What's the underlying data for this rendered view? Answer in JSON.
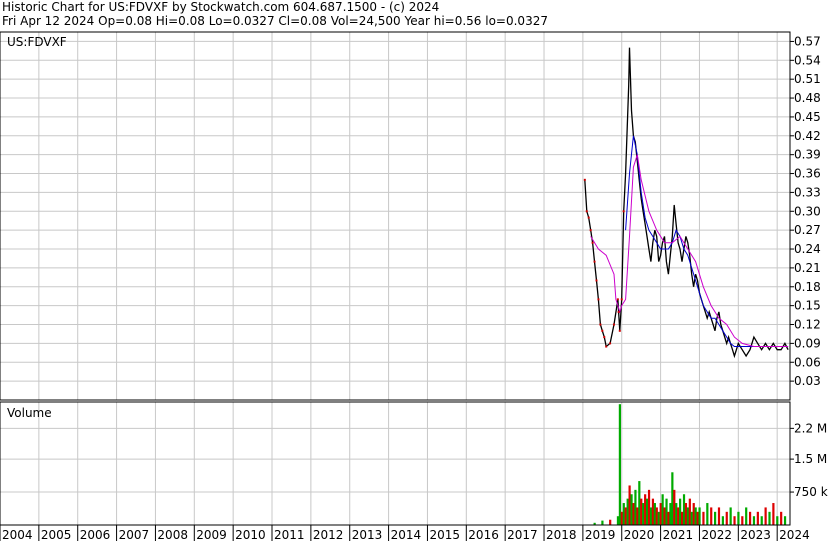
{
  "header": {
    "line1": "Historic Chart for US:FDVXF by Stockwatch.com 604.687.1500 - (c) 2024",
    "line2": "Fri Apr 12 2024   Op=0.08  Hi=0.08  Lo=0.0327  Cl=0.08  Vol=24,500  Year hi=0.56  lo=0.0327"
  },
  "price_panel": {
    "symbol_label": "US:FDVXF"
  },
  "volume_panel": {
    "label": "Volume"
  },
  "chart_data": [
    {
      "type": "line",
      "title": "US:FDVXF",
      "y_ticks": [
        "0.57",
        "0.54",
        "0.51",
        "0.48",
        "0.45",
        "0.42",
        "0.39",
        "0.36",
        "0.33",
        "0.30",
        "0.27",
        "0.24",
        "0.21",
        "0.18",
        "0.15",
        "0.12",
        "0.09",
        "0.06",
        "0.03"
      ],
      "ylim": [
        0.0,
        0.585
      ],
      "xlim": [
        2004.0,
        2024.33
      ],
      "grid": true,
      "colors": {
        "price": "#000000",
        "ma_short": "#0000cc",
        "ma_long": "#cc00cc",
        "sparse_marks": "#cc0000"
      },
      "series": [
        {
          "name": "",
          "x": [
            2019.05,
            2019.1,
            2019.15,
            2019.2,
            2019.25,
            2019.3,
            2019.35,
            2019.4,
            2019.45,
            2019.5,
            2019.55,
            2019.6,
            2019.7,
            2019.8,
            2019.9,
            2019.92,
            2019.95,
            2020.0,
            2020.05,
            2020.1,
            2020.15,
            2020.18,
            2020.2,
            2020.22,
            2020.25,
            2020.3,
            2020.35,
            2020.4,
            2020.45,
            2020.5,
            2020.55,
            2020.6,
            2020.65,
            2020.7,
            2020.75,
            2020.8,
            2020.85,
            2020.9,
            2020.95,
            2021.0,
            2021.05,
            2021.1,
            2021.15,
            2021.2,
            2021.25,
            2021.3,
            2021.35,
            2021.4,
            2021.45,
            2021.5,
            2021.55,
            2021.6,
            2021.65,
            2021.7,
            2021.75,
            2021.8,
            2021.85,
            2021.9,
            2021.95,
            2022.0,
            2022.05,
            2022.1,
            2022.15,
            2022.2,
            2022.25,
            2022.3,
            2022.35,
            2022.4,
            2022.45,
            2022.5,
            2022.55,
            2022.6,
            2022.65,
            2022.7,
            2022.75,
            2022.8,
            2022.85,
            2022.9,
            2022.95,
            2023.0,
            2023.1,
            2023.2,
            2023.3,
            2023.4,
            2023.5,
            2023.6,
            2023.7,
            2023.8,
            2023.9,
            2024.0,
            2024.1,
            2024.2,
            2024.28
          ],
          "y": [
            0.35,
            0.3,
            0.29,
            0.27,
            0.25,
            0.22,
            0.19,
            0.16,
            0.12,
            0.11,
            0.1,
            0.085,
            0.09,
            0.12,
            0.16,
            0.14,
            0.11,
            0.16,
            0.3,
            0.36,
            0.45,
            0.5,
            0.56,
            0.52,
            0.46,
            0.42,
            0.41,
            0.38,
            0.35,
            0.32,
            0.3,
            0.28,
            0.26,
            0.24,
            0.22,
            0.25,
            0.27,
            0.26,
            0.22,
            0.23,
            0.25,
            0.26,
            0.22,
            0.2,
            0.23,
            0.26,
            0.31,
            0.28,
            0.25,
            0.24,
            0.22,
            0.24,
            0.26,
            0.25,
            0.23,
            0.2,
            0.18,
            0.2,
            0.19,
            0.17,
            0.16,
            0.15,
            0.14,
            0.13,
            0.14,
            0.13,
            0.12,
            0.11,
            0.13,
            0.14,
            0.12,
            0.11,
            0.1,
            0.09,
            0.1,
            0.09,
            0.08,
            0.07,
            0.08,
            0.09,
            0.08,
            0.07,
            0.08,
            0.1,
            0.09,
            0.08,
            0.09,
            0.08,
            0.09,
            0.08,
            0.08,
            0.09,
            0.08
          ]
        },
        {
          "name": "",
          "x": [
            2020.1,
            2020.2,
            2020.3,
            2020.4,
            2020.5,
            2020.6,
            2020.7,
            2020.8,
            2020.9,
            2021.0,
            2021.1,
            2021.2,
            2021.3,
            2021.4,
            2021.5,
            2021.6,
            2021.7,
            2021.8,
            2021.9,
            2022.0,
            2022.1,
            2022.2,
            2022.3,
            2022.4,
            2022.5,
            2022.6,
            2022.7,
            2022.8,
            2022.9,
            2023.0,
            2023.2,
            2023.4,
            2023.6,
            2023.8,
            2024.0,
            2024.2,
            2024.28
          ],
          "y": [
            0.27,
            0.36,
            0.42,
            0.39,
            0.33,
            0.29,
            0.27,
            0.26,
            0.25,
            0.24,
            0.24,
            0.24,
            0.25,
            0.27,
            0.26,
            0.24,
            0.23,
            0.21,
            0.19,
            0.17,
            0.15,
            0.14,
            0.13,
            0.13,
            0.12,
            0.11,
            0.1,
            0.09,
            0.085,
            0.085,
            0.085,
            0.085,
            0.085,
            0.085,
            0.085,
            0.085,
            0.085
          ]
        },
        {
          "name": "",
          "x": [
            2019.2,
            2019.4,
            2019.6,
            2019.8,
            2019.85,
            2019.9,
            2019.95,
            2020.0,
            2020.1,
            2020.2,
            2020.3,
            2020.4,
            2020.5,
            2020.7,
            2020.9,
            2021.1,
            2021.3,
            2021.5,
            2021.7,
            2021.9,
            2022.1,
            2022.3,
            2022.5,
            2022.7,
            2022.9,
            2023.1,
            2023.4,
            2023.7,
            2024.0,
            2024.28
          ],
          "y": [
            0.26,
            0.24,
            0.23,
            0.2,
            0.16,
            0.15,
            0.14,
            0.15,
            0.16,
            0.26,
            0.37,
            0.39,
            0.35,
            0.3,
            0.27,
            0.25,
            0.25,
            0.26,
            0.24,
            0.22,
            0.18,
            0.15,
            0.13,
            0.12,
            0.1,
            0.09,
            0.085,
            0.085,
            0.085,
            0.085
          ]
        }
      ]
    },
    {
      "type": "bar",
      "title": "Volume",
      "y_ticks": [
        "2.2 M",
        "1.5 M",
        "750 k"
      ],
      "ylim": [
        0,
        2.8
      ],
      "y_unit": "M",
      "xlim": [
        2004.0,
        2024.33
      ],
      "grid": true,
      "colors": {
        "up": "#00aa00",
        "down": "#dd0000"
      },
      "x": [
        2019.3,
        2019.5,
        2019.7,
        2019.9,
        2019.95,
        2020.0,
        2020.05,
        2020.1,
        2020.15,
        2020.2,
        2020.25,
        2020.3,
        2020.35,
        2020.4,
        2020.45,
        2020.5,
        2020.55,
        2020.6,
        2020.65,
        2020.7,
        2020.75,
        2020.8,
        2020.85,
        2020.9,
        2020.95,
        2021.0,
        2021.05,
        2021.1,
        2021.15,
        2021.2,
        2021.25,
        2021.3,
        2021.35,
        2021.4,
        2021.45,
        2021.5,
        2021.55,
        2021.6,
        2021.65,
        2021.7,
        2021.75,
        2021.8,
        2021.85,
        2021.9,
        2021.95,
        2022.0,
        2022.1,
        2022.2,
        2022.3,
        2022.4,
        2022.5,
        2022.6,
        2022.7,
        2022.8,
        2022.9,
        2023.0,
        2023.1,
        2023.2,
        2023.3,
        2023.4,
        2023.5,
        2023.6,
        2023.7,
        2023.8,
        2023.9,
        2024.0,
        2024.1,
        2024.2
      ],
      "values": [
        0.05,
        0.1,
        0.12,
        0.2,
        2.75,
        0.3,
        0.5,
        0.4,
        0.6,
        0.9,
        0.7,
        0.5,
        0.8,
        0.4,
        1.0,
        0.6,
        0.5,
        0.7,
        0.6,
        0.8,
        0.4,
        0.6,
        0.5,
        0.4,
        0.3,
        0.5,
        0.7,
        0.4,
        0.6,
        0.3,
        0.5,
        1.2,
        0.8,
        0.5,
        0.4,
        0.6,
        0.3,
        0.7,
        0.5,
        0.4,
        0.6,
        0.3,
        0.5,
        0.4,
        0.3,
        0.4,
        0.3,
        0.5,
        0.4,
        0.3,
        0.4,
        0.2,
        0.3,
        0.4,
        0.2,
        0.3,
        0.2,
        0.4,
        0.3,
        0.2,
        0.3,
        0.2,
        0.4,
        0.3,
        0.5,
        0.2,
        0.3,
        0.2
      ],
      "up": [
        true,
        true,
        false,
        true,
        true,
        false,
        true,
        false,
        true,
        false,
        true,
        false,
        true,
        false,
        true,
        false,
        true,
        false,
        true,
        false,
        true,
        false,
        true,
        false,
        true,
        false,
        true,
        false,
        true,
        false,
        true,
        true,
        false,
        true,
        false,
        true,
        false,
        true,
        false,
        true,
        false,
        true,
        false,
        true,
        false,
        true,
        false,
        true,
        false,
        true,
        false,
        true,
        false,
        true,
        false,
        true,
        false,
        true,
        false,
        true,
        false,
        true,
        false,
        true,
        false,
        true,
        false,
        true
      ]
    }
  ],
  "x_axis": {
    "labels": [
      "2004",
      "2005",
      "2006",
      "2007",
      "2008",
      "2009",
      "2010",
      "2011",
      "2012",
      "2013",
      "2014",
      "2015",
      "2016",
      "2017",
      "2018",
      "2019",
      "2020",
      "2021",
      "2022",
      "2023",
      "2024"
    ]
  }
}
